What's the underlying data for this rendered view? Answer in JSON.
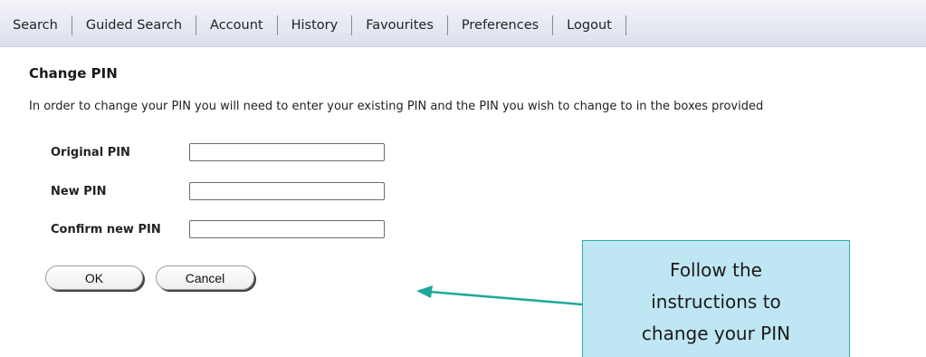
{
  "nav": {
    "items": [
      "Search",
      "Guided Search",
      "Account",
      "History",
      "Favourites",
      "Preferences",
      "Logout"
    ]
  },
  "page": {
    "title": "Change PIN",
    "intro": "In order to change your PIN you will need to enter your existing PIN and the PIN you wish to change to in the boxes provided"
  },
  "form": {
    "original_label": "Original PIN",
    "original_value": "",
    "new_label": "New PIN",
    "new_value": "",
    "confirm_label": "Confirm new PIN",
    "confirm_value": "",
    "ok_label": "OK",
    "cancel_label": "Cancel"
  },
  "callout": {
    "lines": [
      "Follow the",
      "instructions to",
      "change your PIN"
    ],
    "colors": {
      "fill": "#bfe6f3",
      "border": "#26b2aa",
      "arrow": "#1fa89a"
    }
  }
}
